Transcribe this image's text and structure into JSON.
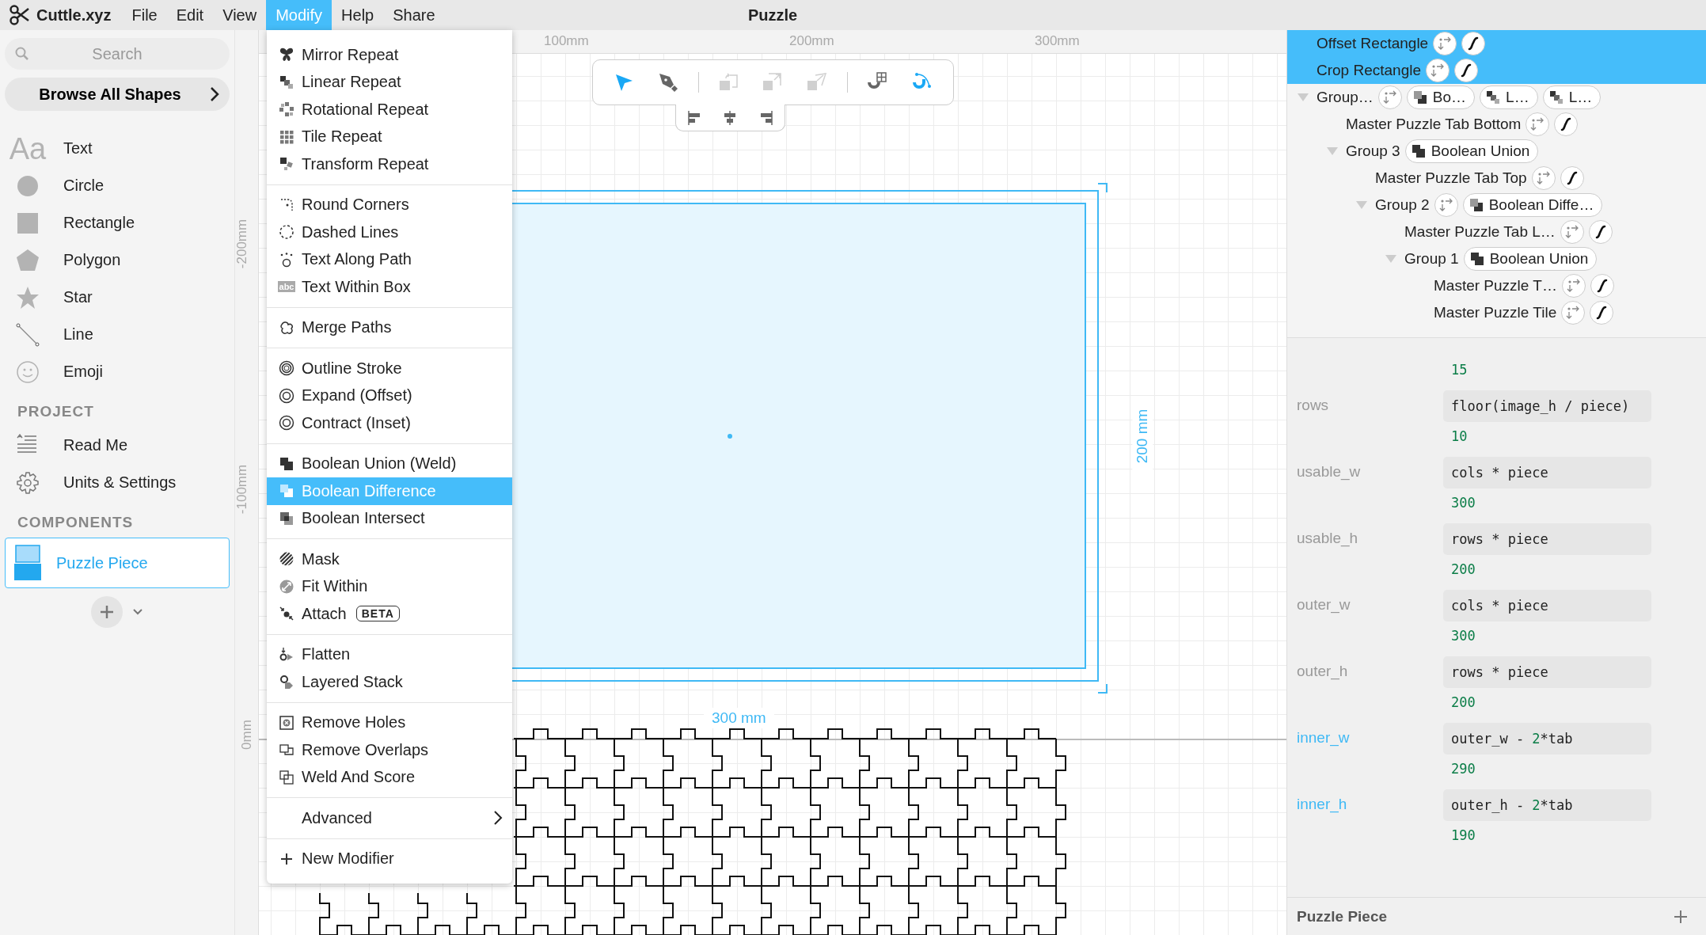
{
  "app": {
    "name": "Cuttle.xyz"
  },
  "menu_bar": [
    {
      "label": "File",
      "selected": false
    },
    {
      "label": "Edit",
      "selected": false
    },
    {
      "label": "View",
      "selected": false
    },
    {
      "label": "Modify",
      "selected": true
    },
    {
      "label": "Help",
      "selected": false
    },
    {
      "label": "Share",
      "selected": false
    }
  ],
  "document_title": "Puzzle",
  "sidebar": {
    "search": {
      "placeholder": "Search"
    },
    "browse_button": "Browse All Shapes",
    "shapes": [
      {
        "kind": "text",
        "icon_text": "Aa",
        "label": "Text"
      },
      {
        "kind": "circle",
        "label": "Circle"
      },
      {
        "kind": "rectangle",
        "label": "Rectangle"
      },
      {
        "kind": "polygon",
        "label": "Polygon"
      },
      {
        "kind": "star",
        "label": "Star"
      },
      {
        "kind": "line",
        "label": "Line"
      },
      {
        "kind": "emoji",
        "label": "Emoji"
      }
    ],
    "project": {
      "heading": "PROJECT",
      "items": [
        {
          "kind": "readme",
          "label": "Read Me"
        },
        {
          "kind": "settings",
          "label": "Units & Settings"
        }
      ]
    },
    "components": {
      "heading": "COMPONENTS",
      "items": [
        {
          "label": "Puzzle Piece",
          "selected": true
        }
      ]
    }
  },
  "modify_menu": {
    "groups": [
      {
        "items": [
          {
            "kind": "mirror",
            "label": "Mirror Repeat",
            "selected": false
          },
          {
            "kind": "linear",
            "label": "Linear Repeat",
            "selected": false
          },
          {
            "kind": "rotational",
            "label": "Rotational Repeat",
            "selected": false
          },
          {
            "kind": "tile",
            "label": "Tile Repeat",
            "selected": false
          },
          {
            "kind": "transform",
            "label": "Transform Repeat",
            "selected": false
          }
        ]
      },
      {
        "items": [
          {
            "kind": "round",
            "label": "Round Corners",
            "selected": false
          },
          {
            "kind": "dashed",
            "label": "Dashed Lines",
            "selected": false
          },
          {
            "kind": "textpath",
            "label": "Text Along Path",
            "selected": false
          },
          {
            "kind": "textbox",
            "icon_text": "abc",
            "label": "Text Within Box",
            "selected": false
          }
        ]
      },
      {
        "items": [
          {
            "kind": "merge",
            "label": "Merge Paths",
            "selected": false
          }
        ]
      },
      {
        "items": [
          {
            "kind": "outline",
            "label": "Outline Stroke",
            "selected": false
          },
          {
            "kind": "expand",
            "label": "Expand (Offset)",
            "selected": false
          },
          {
            "kind": "contract",
            "label": "Contract (Inset)",
            "selected": false
          }
        ]
      },
      {
        "items": [
          {
            "kind": "union",
            "label": "Boolean Union (Weld)",
            "selected": false
          },
          {
            "kind": "difference",
            "label": "Boolean Difference",
            "selected": true
          },
          {
            "kind": "intersect",
            "label": "Boolean Intersect",
            "selected": false
          }
        ]
      },
      {
        "items": [
          {
            "kind": "mask",
            "label": "Mask",
            "selected": false
          },
          {
            "kind": "fit",
            "label": "Fit Within",
            "selected": false
          },
          {
            "kind": "attach",
            "label": "Attach",
            "badge": "BETA",
            "selected": false
          }
        ]
      },
      {
        "items": [
          {
            "kind": "flatten",
            "label": "Flatten",
            "selected": false
          },
          {
            "kind": "layered",
            "label": "Layered Stack",
            "selected": false
          }
        ]
      },
      {
        "items": [
          {
            "kind": "removeholes",
            "label": "Remove Holes",
            "selected": false
          },
          {
            "kind": "removeoverlaps",
            "label": "Remove Overlaps",
            "selected": false
          },
          {
            "kind": "weld",
            "label": "Weld And Score",
            "selected": false
          }
        ]
      },
      {
        "items": [
          {
            "kind": "submenu",
            "label": "Advanced",
            "selected": false
          }
        ]
      },
      {
        "items": [
          {
            "kind": "plus",
            "label": "New Modifier",
            "selected": false
          }
        ]
      }
    ]
  },
  "canvas": {
    "rulers": {
      "top": [
        "100mm",
        "200mm",
        "300mm"
      ],
      "left": [
        "-200mm",
        "-100mm",
        "0mm"
      ]
    },
    "toolbar": [
      {
        "kind": "select",
        "selected": true,
        "disabled": false
      },
      {
        "kind": "pen",
        "selected": false,
        "disabled": false
      },
      {
        "kind": "sep"
      },
      {
        "kind": "rotate",
        "selected": false,
        "disabled": true
      },
      {
        "kind": "scale",
        "selected": false,
        "disabled": true
      },
      {
        "kind": "skew",
        "selected": false,
        "disabled": true
      },
      {
        "kind": "sep"
      },
      {
        "kind": "snapgrid",
        "selected": false,
        "disabled": false
      },
      {
        "kind": "snapgeom",
        "selected": true,
        "disabled": false
      }
    ],
    "align_tools": [
      {
        "kind": "left"
      },
      {
        "kind": "center"
      },
      {
        "kind": "right"
      }
    ],
    "width_label": "300 mm",
    "height_label": "200 mm"
  },
  "layers": [
    {
      "label": "Offset Rectangle",
      "kind": "shape",
      "selected": true,
      "chips": [
        {
          "kind": "transform"
        },
        {
          "kind": "edit"
        }
      ]
    },
    {
      "label": "Crop Rectangle",
      "kind": "shape",
      "selected": true,
      "chips": [
        {
          "kind": "transform"
        },
        {
          "kind": "edit"
        }
      ]
    },
    {
      "label": "Group…",
      "kind": "group",
      "expanded": true,
      "selected": false,
      "chips": [
        {
          "kind": "transform"
        },
        {
          "kind": "difference",
          "label": "Bo…"
        },
        {
          "kind": "linear",
          "label": "L…"
        },
        {
          "kind": "linear",
          "label": "L…"
        }
      ],
      "children": [
        {
          "label": "Master Puzzle Tab Bottom",
          "kind": "shape",
          "selected": false,
          "chips": [
            {
              "kind": "transform"
            },
            {
              "kind": "edit"
            }
          ]
        },
        {
          "label": "Group 3",
          "kind": "group",
          "expanded": true,
          "selected": false,
          "chips": [
            {
              "kind": "union",
              "label": "Boolean Union"
            }
          ],
          "children": [
            {
              "label": "Master Puzzle Tab Top",
              "kind": "shape",
              "selected": false,
              "chips": [
                {
                  "kind": "transform"
                },
                {
                  "kind": "edit"
                }
              ]
            },
            {
              "label": "Group 2",
              "kind": "group",
              "expanded": true,
              "selected": false,
              "chips": [
                {
                  "kind": "transform"
                },
                {
                  "kind": "difference",
                  "label": "Boolean Diffe…"
                }
              ],
              "children": [
                {
                  "label": "Master Puzzle Tab L…",
                  "kind": "shape",
                  "selected": false,
                  "chips": [
                    {
                      "kind": "transform"
                    },
                    {
                      "kind": "edit"
                    }
                  ]
                },
                {
                  "label": "Group 1",
                  "kind": "group",
                  "expanded": true,
                  "selected": false,
                  "chips": [
                    {
                      "kind": "union",
                      "label": "Boolean Union"
                    }
                  ],
                  "children": [
                    {
                      "label": "Master Puzzle T…",
                      "kind": "shape",
                      "selected": false,
                      "chips": [
                        {
                          "kind": "transform"
                        },
                        {
                          "kind": "edit"
                        }
                      ]
                    },
                    {
                      "label": "Master Puzzle Tile",
                      "kind": "shape",
                      "selected": false,
                      "chips": [
                        {
                          "kind": "transform"
                        },
                        {
                          "kind": "edit"
                        }
                      ]
                    }
                  ]
                }
              ]
            }
          ]
        }
      ]
    }
  ],
  "parameters": [
    {
      "result": "15"
    },
    {
      "name": "rows",
      "highlighted": false,
      "expression": "floor(image_h / piece)",
      "result": "10"
    },
    {
      "name": "usable_w",
      "highlighted": false,
      "expression": "cols * piece",
      "result": "300"
    },
    {
      "name": "usable_h",
      "highlighted": false,
      "expression": "rows * piece",
      "result": "200"
    },
    {
      "name": "outer_w",
      "highlighted": false,
      "expression": "cols * piece",
      "result": "300"
    },
    {
      "name": "outer_h",
      "highlighted": false,
      "expression": "rows * piece",
      "result": "200"
    },
    {
      "name": "inner_w",
      "highlighted": true,
      "expression": "outer_w - 2*tab",
      "result": "290"
    },
    {
      "name": "inner_h",
      "highlighted": true,
      "expression": "outer_h - 2*tab",
      "result": "190"
    }
  ],
  "footer": {
    "title": "Puzzle Piece"
  }
}
